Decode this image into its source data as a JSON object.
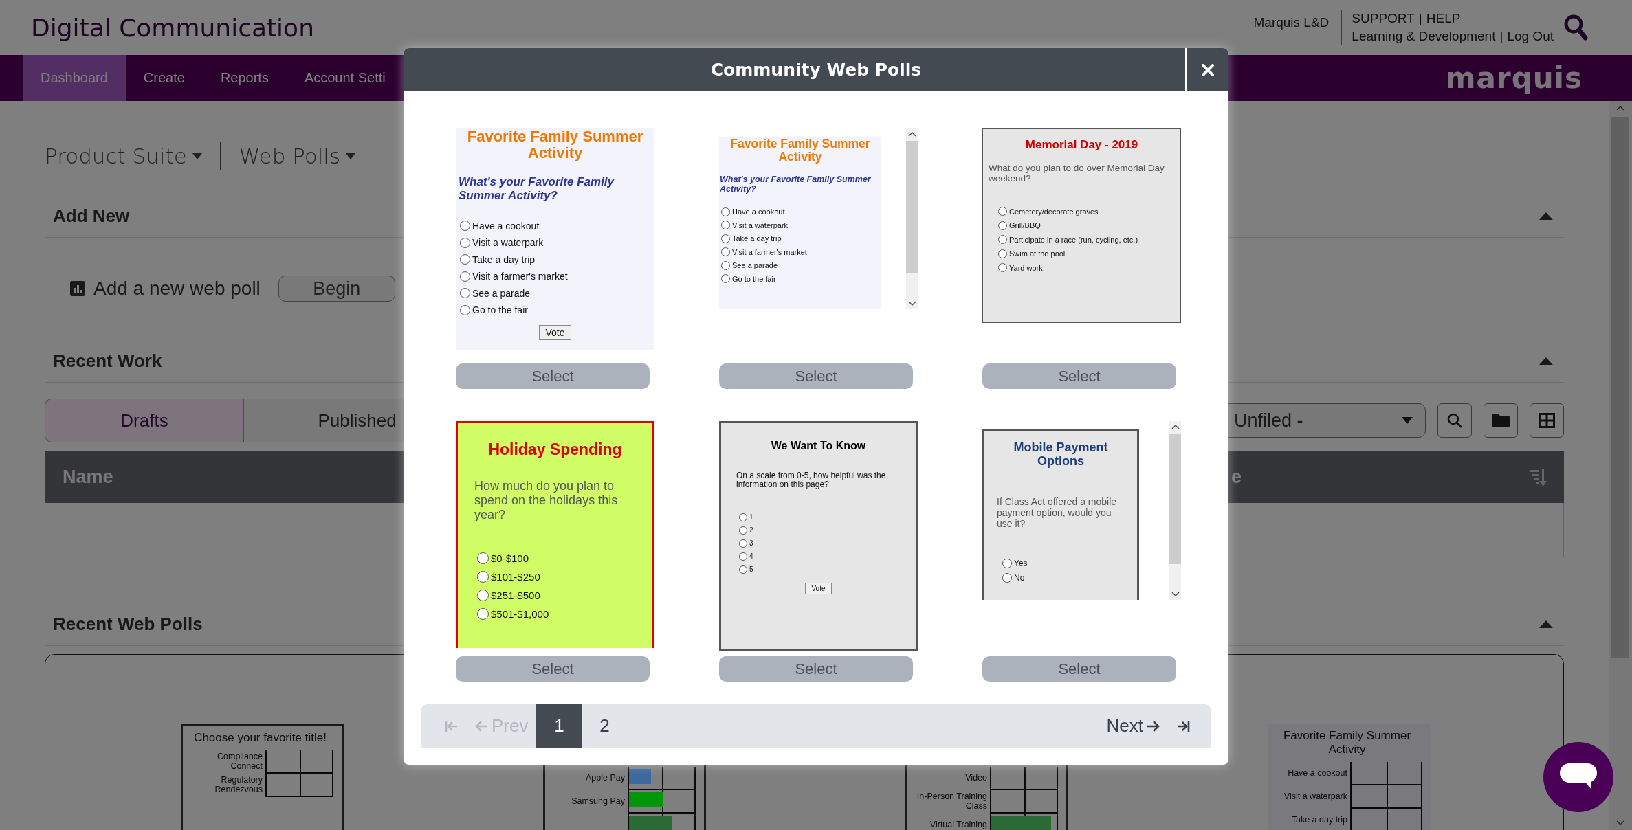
{
  "header": {
    "title": "Digital Communication",
    "user": "Marquis L&D",
    "links_top": [
      "SUPPORT",
      "HELP"
    ],
    "links_bottom": [
      "Learning & Development",
      "Log Out"
    ],
    "separator": "|"
  },
  "nav": {
    "items": [
      {
        "label": "Dashboard",
        "selected": true
      },
      {
        "label": "Create",
        "selected": false
      },
      {
        "label": "Reports",
        "selected": false
      },
      {
        "label": "Account Setti",
        "selected": false
      }
    ],
    "logo": "marquis"
  },
  "breadcrumb": [
    {
      "label": "Product Suite"
    },
    {
      "label": "Web Polls"
    }
  ],
  "add_new": {
    "title": "Add New",
    "expanded": true,
    "label": "Add a new web poll",
    "button": "Begin"
  },
  "recent_work": {
    "title": "Recent Work",
    "expanded": true,
    "tabs": [
      {
        "label": "Drafts",
        "selected": true
      },
      {
        "label": "Published",
        "selected": false
      }
    ],
    "folder_select": "Unfiled -",
    "columns": [
      "Name",
      "e"
    ]
  },
  "recent_web_polls": {
    "title": "Recent Web Polls",
    "expanded": true,
    "thumbnails": [
      {
        "kind": "full",
        "title": "Choose your favorite title!",
        "rows": [
          {
            "label": "Compliance Connect"
          },
          {
            "label": "Regulatory Rendezvous"
          }
        ]
      },
      {
        "kind": "lower",
        "rows": [
          {
            "label": "Apple Pay",
            "level": 0.33,
            "color": "#3d68a0"
          },
          {
            "label": "Samsung Pay",
            "level": 0.5,
            "color": "#00960a"
          },
          {
            "level": 0.65,
            "color": "#2a6a36"
          }
        ]
      },
      {
        "kind": "lower",
        "rows": [
          {
            "label": "Video"
          },
          {
            "label": "In-Person Training Class"
          },
          {
            "label": "Virtual Training",
            "level": 0.9,
            "color": "#2a6a36"
          }
        ]
      },
      {
        "kind": "light",
        "title": "Favorite Family Summer Activity",
        "rows": [
          {
            "label": "Have a cookout"
          },
          {
            "label": "Visit a waterpark"
          },
          {
            "label": "Take a day trip"
          }
        ]
      }
    ]
  },
  "modal": {
    "title": "Community Web Polls",
    "cards": [
      {
        "select": "Select",
        "preview": {
          "kind": "summer",
          "title": "Favorite Family Summer Activity",
          "question": "What's your Favorite Family Summer Activity?",
          "options": [
            "Have a cookout",
            "Visit a waterpark",
            "Take a day trip",
            "Visit a farmer's market",
            "See a parade",
            "Go to the fair"
          ],
          "vote": "Vote",
          "scrollbar": false
        }
      },
      {
        "select": "Select",
        "preview": {
          "kind": "summer_small",
          "title": "Favorite Family Summer Activity",
          "question": "What's your Favorite Family Summer Activity?",
          "options": [
            "Have a cookout",
            "Visit a waterpark",
            "Take a day trip",
            "Visit a farmer's market",
            "See a parade",
            "Go to the fair"
          ],
          "scrollbar": true
        }
      },
      {
        "select": "Select",
        "preview": {
          "kind": "memorial",
          "title": "Memorial Day - 2019",
          "question": "What do you plan to do over Memorial Day weekend?",
          "options": [
            "Cemetery/decorate graves",
            "Grill/BBQ",
            "Participate in a race (run, cycling, etc.)",
            "Swim at the pool",
            "Yard work"
          ],
          "scrollbar": false
        }
      },
      {
        "select": "Select",
        "preview": {
          "kind": "holiday",
          "title": "Holiday Spending",
          "question": "How much do you plan to spend on the holidays this year?",
          "options": [
            "$0-$100",
            "$101-$250",
            "$251-$500",
            "$501-$1,000"
          ],
          "scrollbar": false
        }
      },
      {
        "select": "Select",
        "preview": {
          "kind": "know",
          "title": "We Want To Know",
          "question": "On a scale from 0-5, how helpful was the information on this page?",
          "options": [
            "1",
            "2",
            "3",
            "4",
            "5"
          ],
          "vote": "Vote",
          "scrollbar": false
        }
      },
      {
        "select": "Select",
        "preview": {
          "kind": "mobile",
          "title": "Mobile Payment Options",
          "question": "If Class Act offered a mobile payment option, would you use it?",
          "options": [
            "Yes",
            "No"
          ],
          "scrollbar": true
        }
      }
    ],
    "pagination": {
      "first_disabled": true,
      "prev": {
        "label": "Prev",
        "disabled": true
      },
      "pages": [
        {
          "label": "1",
          "selected": true
        },
        {
          "label": "2",
          "selected": false
        }
      ],
      "next": {
        "label": "Next",
        "disabled": false
      },
      "last_disabled": false
    }
  }
}
